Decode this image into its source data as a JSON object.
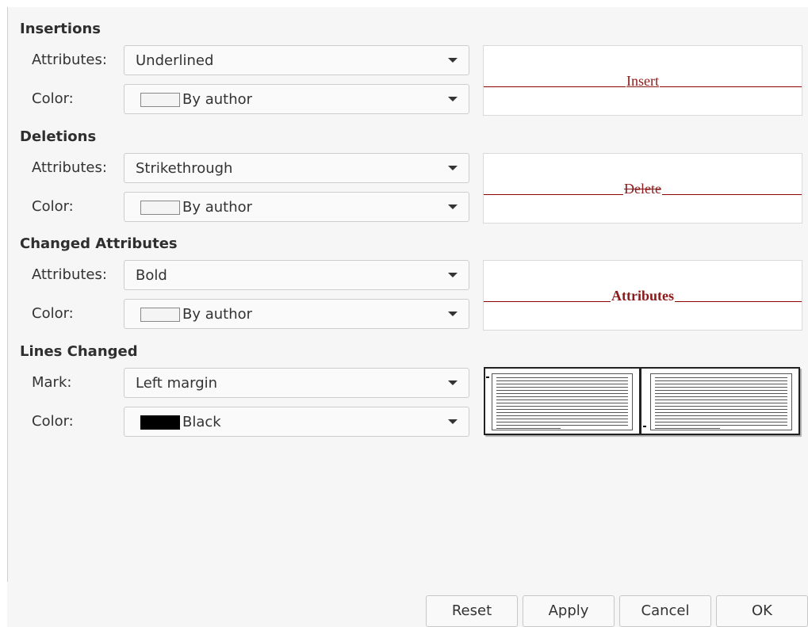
{
  "insertions": {
    "title": "Insertions",
    "attributes_label": "Attributes:",
    "attributes_value": "Underlined",
    "color_label": "Color:",
    "color_value": "By author",
    "preview_text": "Insert"
  },
  "deletions": {
    "title": "Deletions",
    "attributes_label": "Attributes:",
    "attributes_value": "Strikethrough",
    "color_label": "Color:",
    "color_value": "By author",
    "preview_text": "Delete"
  },
  "changed_attributes": {
    "title": "Changed Attributes",
    "attributes_label": "Attributes:",
    "attributes_value": "Bold",
    "color_label": "Color:",
    "color_value": "By author",
    "preview_text": "Attributes"
  },
  "lines_changed": {
    "title": "Lines Changed",
    "mark_label": "Mark:",
    "mark_value": "Left margin",
    "color_label": "Color:",
    "color_value": "Black"
  },
  "colors": {
    "preview_text": "#8b1a1a",
    "black_swatch": "#000000",
    "author_swatch": "#f4f4f4"
  },
  "buttons": {
    "reset": "Reset",
    "apply": "Apply",
    "cancel": "Cancel",
    "ok": "OK"
  }
}
